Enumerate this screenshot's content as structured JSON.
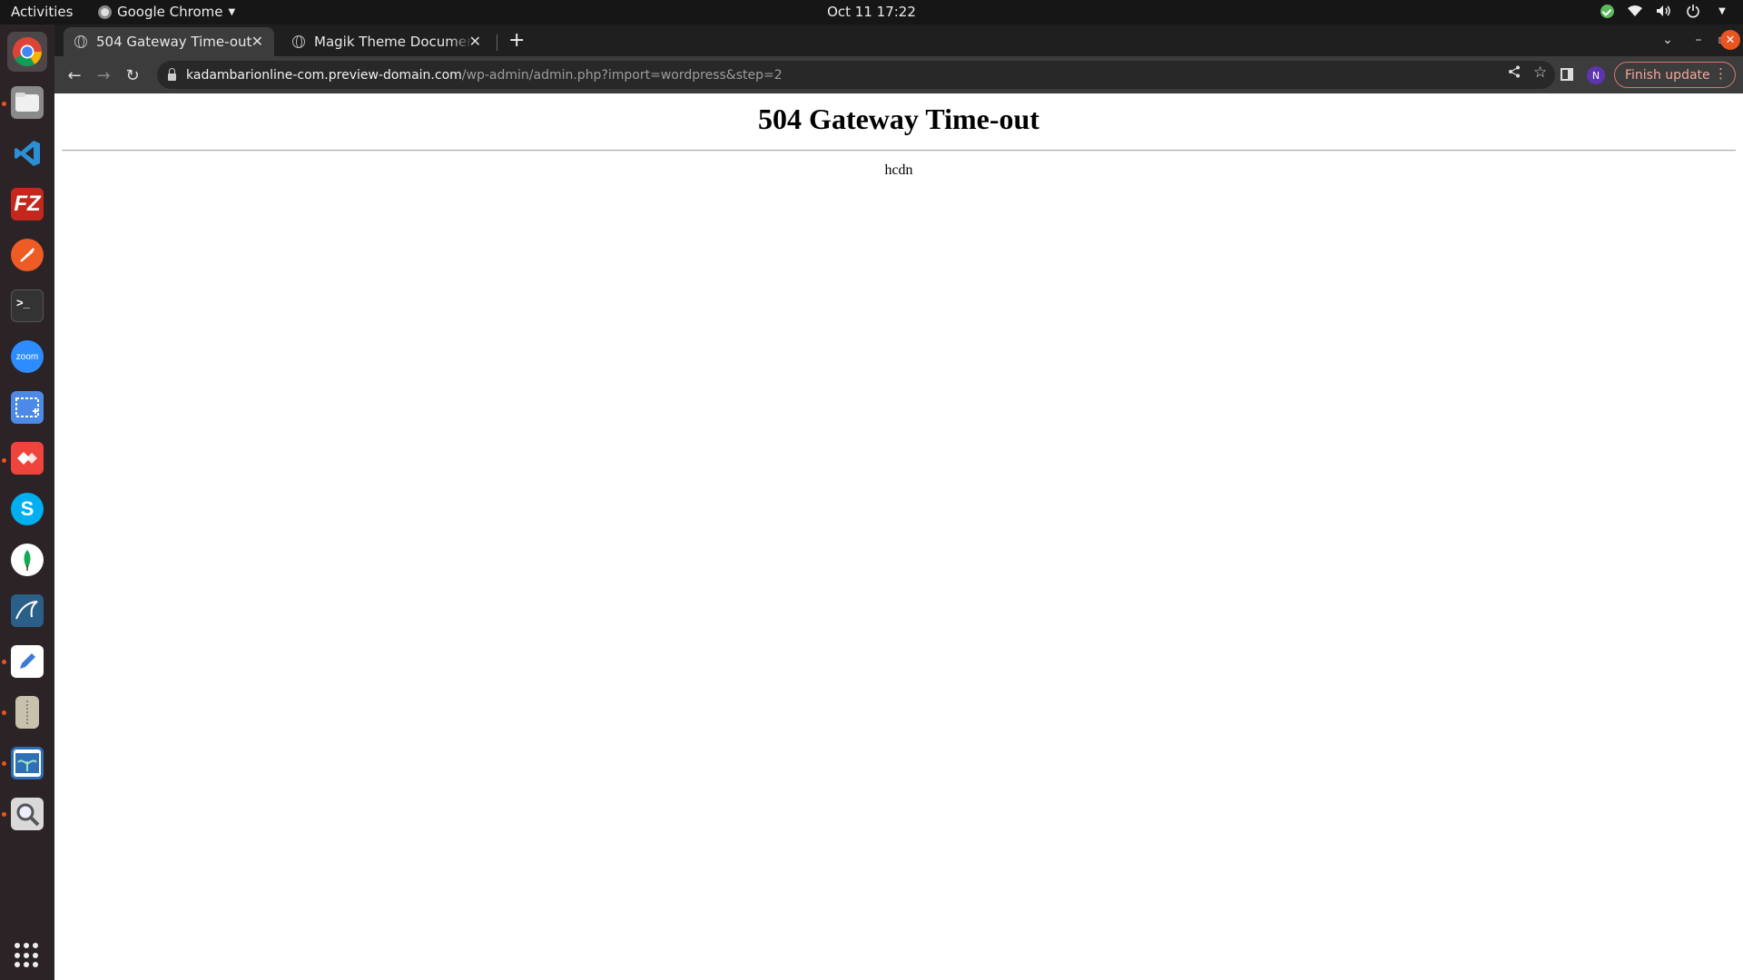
{
  "topbar": {
    "activities": "Activities",
    "app_name": "Google Chrome",
    "clock": "Oct 11  17:22",
    "tray_icons": [
      "update-check-icon",
      "wifi-icon",
      "volume-icon",
      "power-icon",
      "chevron-down-icon"
    ]
  },
  "dock": {
    "apps": [
      {
        "name": "chrome",
        "color": "#ffffff"
      },
      {
        "name": "files",
        "color": "#8a8a8a"
      },
      {
        "name": "vscode",
        "color": "#2b8fd6"
      },
      {
        "name": "filezilla",
        "color": "#c4271c"
      },
      {
        "name": "postman",
        "color": "#ef5b25"
      },
      {
        "name": "terminal",
        "color": "#333333"
      },
      {
        "name": "zoom",
        "color": "#2d8cff"
      },
      {
        "name": "screenshot",
        "color": "#4d8ae8"
      },
      {
        "name": "anydesk",
        "color": "#ef443b"
      },
      {
        "name": "skype",
        "color": "#00aff0"
      },
      {
        "name": "mongodb-compass",
        "color": "#ffffff"
      },
      {
        "name": "mysql-workbench",
        "color": "#2a5f87"
      },
      {
        "name": "text-editor",
        "color": "#ffffff"
      },
      {
        "name": "archive-manager",
        "color": "#c8c1ae"
      },
      {
        "name": "image-viewer",
        "color": "#2f6fb5"
      },
      {
        "name": "search-tool",
        "color": "#d9d9d9"
      }
    ],
    "zoom_label": "zoom"
  },
  "browser": {
    "tabs": [
      {
        "title": "504 Gateway Time-out",
        "active": true
      },
      {
        "title": "Magik Theme Documenta",
        "active": false
      }
    ],
    "url_host": "kadambarionline-com.preview-domain.com",
    "url_path": "/wp-admin/admin.php?import=wordpress&step=2",
    "profile_initial": "N",
    "finish_update": "Finish update"
  },
  "page": {
    "heading": "504 Gateway Time-out",
    "server": "hcdn"
  },
  "colors": {
    "accent": "#e95420",
    "profile": "#5e35b1"
  }
}
